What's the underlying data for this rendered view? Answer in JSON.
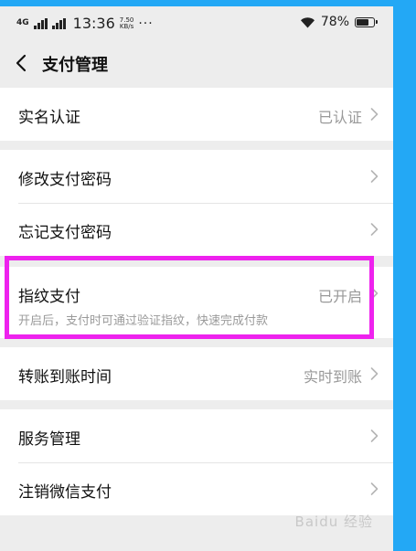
{
  "status_bar": {
    "network": "4G",
    "time": "13:36",
    "speed_value": "7.50",
    "speed_unit": "KB/s",
    "more": "···",
    "battery": "78%",
    "battery_level": 78
  },
  "nav": {
    "title": "支付管理"
  },
  "groups": [
    {
      "rows": [
        {
          "label": "实名认证",
          "value": "已认证"
        }
      ]
    },
    {
      "rows": [
        {
          "label": "修改支付密码",
          "value": ""
        },
        {
          "label": "忘记支付密码",
          "value": ""
        }
      ]
    },
    {
      "rows": [
        {
          "label": "指纹支付",
          "value": "已开启",
          "desc": "开启后，支付时可通过验证指纹，快速完成付款"
        }
      ]
    },
    {
      "rows": [
        {
          "label": "转账到账时间",
          "value": "实时到账"
        }
      ]
    },
    {
      "rows": [
        {
          "label": "服务管理",
          "value": ""
        },
        {
          "label": "注销微信支付",
          "value": ""
        }
      ]
    }
  ],
  "colors": {
    "highlight": "#ee22ee",
    "frame": "#23a8f5"
  },
  "watermark": "Baidu 经验"
}
